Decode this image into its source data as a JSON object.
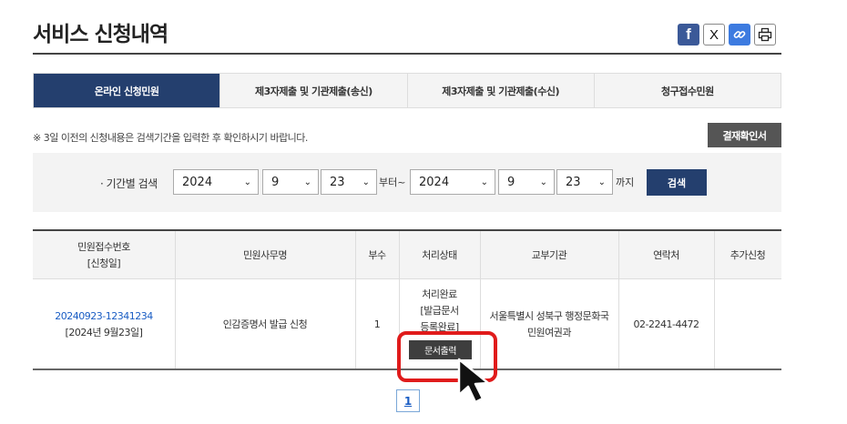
{
  "page": {
    "title": "서비스 신청내역"
  },
  "share": {
    "facebook": "f",
    "x": "X"
  },
  "tabs": [
    {
      "label": "온라인 신청민원"
    },
    {
      "label": "제3자제출 및 기관제출(송신)"
    },
    {
      "label": "제3자제출 및 기관제출(수신)"
    },
    {
      "label": "청구접수민원"
    }
  ],
  "notice": "※ 3일 이전의 신청내용은 검색기간을 입력한 후 확인하시기 바랍니다.",
  "confirm_button": "결재확인서",
  "search": {
    "label": "· 기간별 검색",
    "from_year": "2024",
    "from_month": "9",
    "from_day": "23",
    "from_suffix": "부터~",
    "to_year": "2024",
    "to_month": "9",
    "to_day": "23",
    "to_suffix": "까지",
    "button": "검색"
  },
  "table": {
    "headers": {
      "receipt_no": "민원접수번호",
      "receipt_date": "[신청일]",
      "name": "민원사무명",
      "copies": "부수",
      "status": "처리상태",
      "agency": "교부기관",
      "contact": "연락처",
      "extra": "추가신청"
    },
    "rows": [
      {
        "receipt_no": "20240923-12341234",
        "receipt_date": "[2024년 9월23일]",
        "name": "인감증명서 발급 신청",
        "copies": "1",
        "status_line1": "처리완료",
        "status_line2": "[발급문서",
        "status_line3": "등록완료]",
        "print_button": "문서출력",
        "agency_line1": "서울특별시 성북구 행정문화국",
        "agency_line2": "민원여권과",
        "contact": "02-2241-4472",
        "extra": ""
      }
    ]
  },
  "pagination": {
    "current": "1"
  },
  "colors": {
    "primary": "#243f6e",
    "highlight": "#e01b1b",
    "link": "#1a5dc4"
  }
}
